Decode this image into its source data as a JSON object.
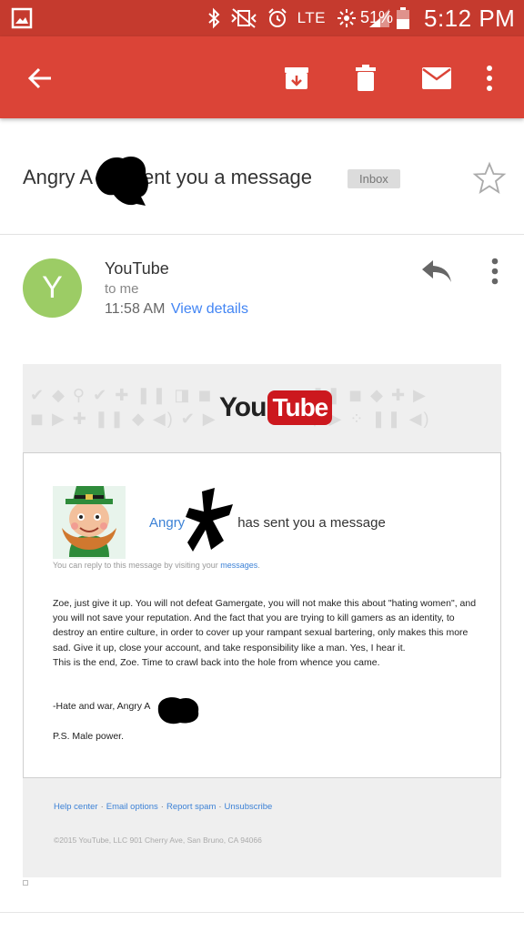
{
  "status_bar": {
    "network": "LTE",
    "battery": "51%",
    "time": "5:12 PM"
  },
  "toolbar": {
    "back_icon": "arrow-left-icon",
    "actions": [
      "archive-icon",
      "delete-icon",
      "mark-unread-icon",
      "more-vert-icon"
    ]
  },
  "subject": {
    "prefix": "Angry A",
    "suffix": "sent you a message",
    "label": "Inbox"
  },
  "sender": {
    "initial": "Y",
    "name": "YouTube",
    "to": "to me",
    "time": "11:58 AM",
    "details_link": "View details"
  },
  "email": {
    "logo_you": "You",
    "logo_tube": "Tube",
    "message_sender": "Angry",
    "message_title": "has sent you a message",
    "hint_prefix": "You can reply to this message by visiting your",
    "hint_link": "messages",
    "hint_suffix": ".",
    "body": [
      "Zoe, just give it up. You will not defeat Gamergate, you will not make this about \"hating women\", and you will not save your reputation. And the fact that you are trying to kill gamers as an identity, to destroy an entire culture, in order to cover up your rampant sexual bartering, only makes this more sad. Give it up, close your account, and take responsibility like a man. Yes, I hear it.",
      "This is the end, Zoe. Time to crawl back into the hole from whence you came."
    ],
    "signature": "-Hate and war, Angry A",
    "postscript": "P.S. Male power.",
    "footer_links": [
      "Help center",
      "Email options",
      "Report spam",
      "Unsubscribe"
    ],
    "copyright": "©2015 YouTube, LLC 901 Cherry Ave, San Bruno, CA 94066"
  },
  "colors": {
    "status_bar": "#c53a2e",
    "toolbar": "#db4437",
    "avatar": "#9ccc65",
    "link": "#4285f4",
    "youtube_red": "#cc181e"
  }
}
